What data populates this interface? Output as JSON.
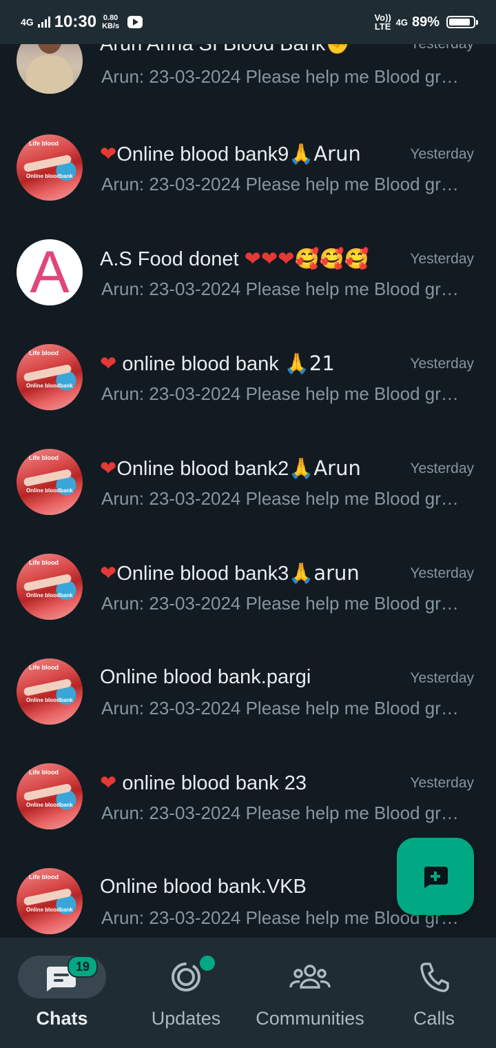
{
  "status_bar": {
    "network_left": "4G",
    "time": "10:30",
    "speed_value": "0.80",
    "speed_unit": "KB/s",
    "volte": "Vo)) LTE",
    "network_right": "4G",
    "battery": "89%",
    "battery_level": 0.89
  },
  "chats": [
    {
      "title": "Arun Anna SI Blood Bank",
      "title_suffix": "✊",
      "time": "Yesterday",
      "preview": "Arun: 23-03-2024 Please help me Blood group",
      "avatar": "police"
    },
    {
      "title_prefix": "❤",
      "title": "Online blood bank9",
      "title_suffix": "🙏Arun",
      "time": "Yesterday",
      "preview": "Arun: 23-03-2024 Please help me Blood group",
      "avatar": "blood"
    },
    {
      "title": "A.S Food donet ",
      "title_suffix": "❤❤❤🥰🥰🥰",
      "time": "Yesterday",
      "preview": "Arun: 23-03-2024 Please help me Blood group",
      "avatar": "letter-a"
    },
    {
      "title_prefix": "❤ ",
      "title": "online blood bank ",
      "title_suffix": "🙏21",
      "time": "Yesterday",
      "preview": "Arun: 23-03-2024 Please help me Blood group",
      "avatar": "blood"
    },
    {
      "title_prefix": "❤",
      "title": "Online blood bank2",
      "title_suffix": "🙏Arun",
      "time": "Yesterday",
      "preview": "Arun: 23-03-2024 Please help me Blood group",
      "avatar": "blood"
    },
    {
      "title_prefix": "❤",
      "title": "Online blood bank3",
      "title_suffix": "🙏arun",
      "time": "Yesterday",
      "preview": "Arun: 23-03-2024 Please help me Blood group",
      "avatar": "blood"
    },
    {
      "title": "Online blood bank.pargi",
      "time": "Yesterday",
      "preview": "Arun: 23-03-2024 Please help me Blood group",
      "avatar": "blood"
    },
    {
      "title_prefix": "❤ ",
      "title": "online blood bank 23",
      "time": "Yesterday",
      "preview": "Arun: 23-03-2024 Please help me Blood group",
      "avatar": "blood"
    },
    {
      "title": "Online blood bank.VKB",
      "time": "",
      "preview": "Arun: 23-03-2024 Please help me Blood group",
      "avatar": "blood"
    }
  ],
  "fab": {
    "icon": "new-chat-icon"
  },
  "nav": {
    "chats": {
      "label": "Chats",
      "badge": "19",
      "icon": "chats-icon"
    },
    "updates": {
      "label": "Updates",
      "icon": "updates-icon"
    },
    "communities": {
      "label": "Communities",
      "icon": "communities-icon"
    },
    "calls": {
      "label": "Calls",
      "icon": "calls-icon"
    }
  },
  "colors": {
    "accent": "#00a884",
    "background": "#121b22",
    "bar": "#1f2c34",
    "secondary_text": "#8696a0"
  }
}
